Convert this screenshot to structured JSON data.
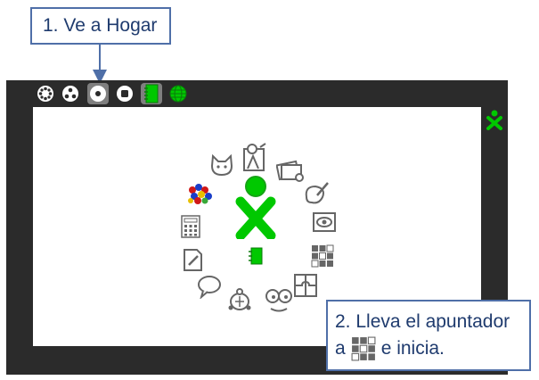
{
  "callouts": {
    "step1": "1. Ve a Hogar",
    "step2_line1": "2. Lleva el apuntador",
    "step2_prefix": "a",
    "step2_suffix": "e inicia."
  },
  "toolbar": {
    "zones": [
      "neighborhood-view",
      "group-view",
      "home-view",
      "activity-view",
      "journal",
      "browse"
    ],
    "selected": "home-view"
  },
  "home": {
    "center": "xo-icon",
    "activities": [
      "cat",
      "painting-figure",
      "photos",
      "paint-palette",
      "eye-view",
      "grid-memorize",
      "puzzle",
      "face-eyes",
      "turtle",
      "chat-bubble",
      "write",
      "calculator",
      "colored-blobs",
      "journal"
    ]
  },
  "colors": {
    "xo_green": "#00c800",
    "xo_stroke": "#16a316",
    "callout_border": "#4f6fa8",
    "callout_text": "#1f3b6e",
    "frame": "#2b2b2b"
  }
}
